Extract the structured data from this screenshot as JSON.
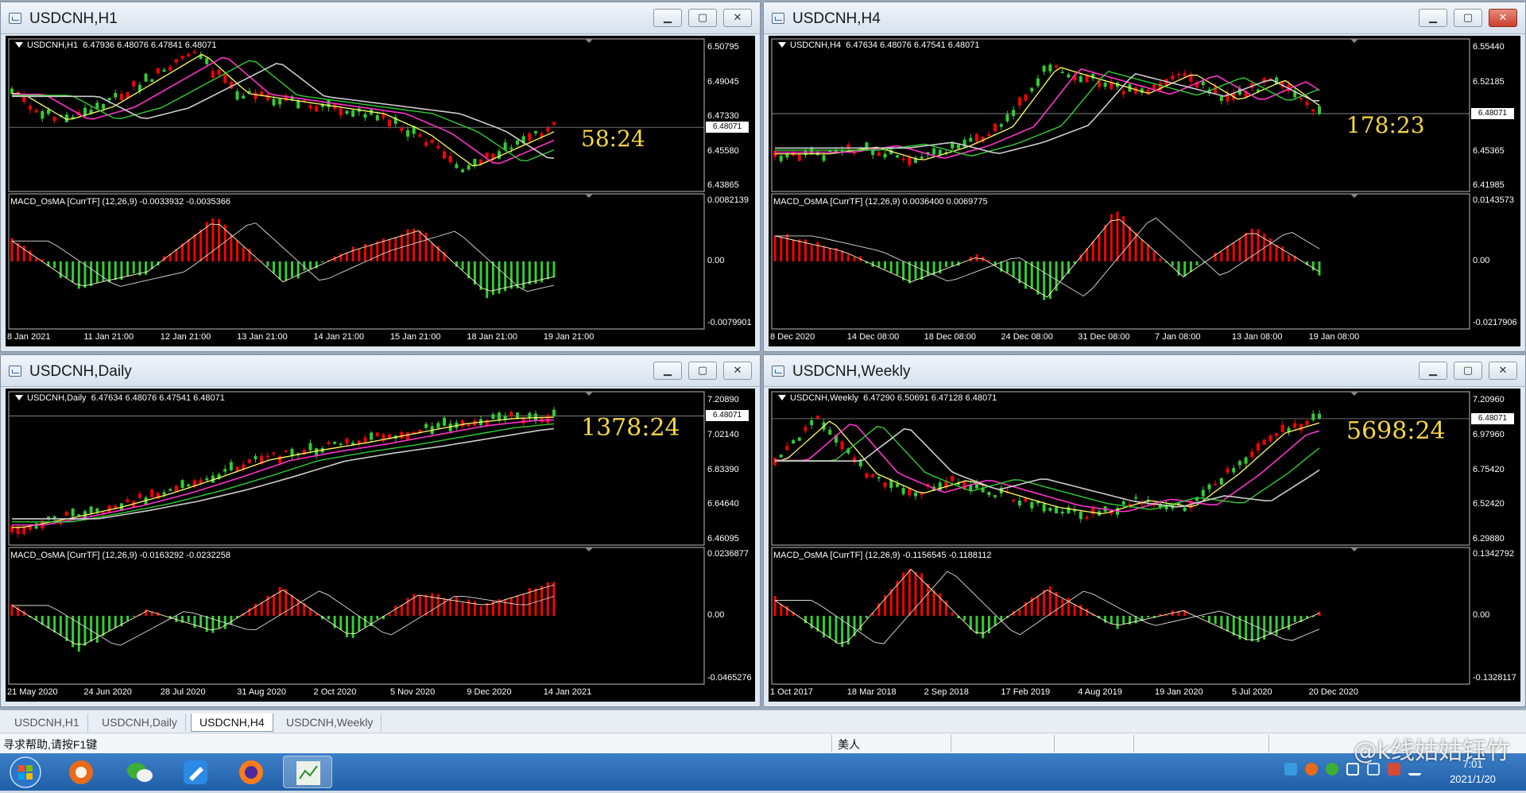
{
  "windows": [
    {
      "title": "USDCNH,H1",
      "close_style": "plain",
      "symbol_line": "USDCNH,H1  6.47936 6.48076 6.47841 6.48071",
      "price_labels": [
        "6.50795",
        "6.49045",
        "6.47330",
        "6.45580",
        "6.43865"
      ],
      "current_price": "6.48071",
      "macd_line": "MACD_OsMA [CurrTF] (12,26,9) -0.0033932 -0.0035366",
      "macd_labels": [
        "0.0082139",
        "0.00",
        "-0.0079901"
      ],
      "time_labels": [
        "8 Jan 2021",
        "11 Jan 21:00",
        "12 Jan 21:00",
        "13 Jan 21:00",
        "14 Jan 21:00",
        "15 Jan 21:00",
        "18 Jan 21:00",
        "19 Jan 21:00"
      ],
      "timer": "58:24"
    },
    {
      "title": "USDCNH,H4",
      "close_style": "red",
      "symbol_line": "USDCNH,H4  6.47634 6.48076 6.47541 6.48071",
      "price_labels": [
        "6.55440",
        "6.52185",
        "6.48745",
        "6.45365",
        "6.41985"
      ],
      "current_price": "6.48071",
      "macd_line": "MACD_OsMA [CurrTF] (12,26,9) 0.0036400 0.0069775",
      "macd_labels": [
        "0.0143573",
        "0.00",
        "-0.0217906"
      ],
      "time_labels": [
        "8 Dec 2020",
        "14 Dec 08:00",
        "18 Dec 08:00",
        "24 Dec 08:00",
        "31 Dec 08:00",
        "7 Jan 08:00",
        "13 Jan 08:00",
        "19 Jan 08:00"
      ],
      "timer": "178:23"
    },
    {
      "title": "USDCNH,Daily",
      "close_style": "plain",
      "symbol_line": "USDCNH,Daily  6.47634 6.48076 6.47541 6.48071",
      "price_labels": [
        "7.20890",
        "7.02140",
        "6.83390",
        "6.64640",
        "6.46095"
      ],
      "current_price": "6.48071",
      "macd_line": "MACD_OsMA [CurrTF] (12,26,9) -0.0163292 -0.0232258",
      "macd_labels": [
        "0.0236877",
        "0.00",
        "-0.0465276"
      ],
      "time_labels": [
        "21 May 2020",
        "24 Jun 2020",
        "28 Jul 2020",
        "31 Aug 2020",
        "2 Oct 2020",
        "5 Nov 2020",
        "9 Dec 2020",
        "14 Jan 2021"
      ],
      "timer": "1378:24"
    },
    {
      "title": "USDCNH,Weekly",
      "close_style": "plain",
      "symbol_line": "USDCNH,Weekly  6.47290 6.50691 6.47128 6.48071",
      "price_labels": [
        "7.20960",
        "6.97960",
        "6.75420",
        "6.52420",
        "6.29880"
      ],
      "current_price": "6.48071",
      "macd_line": "MACD_OsMA [CurrTF] (12,26,9) -0.1156545 -0.1188112",
      "macd_labels": [
        "0.1342792",
        "0.00",
        "-0.1328117"
      ],
      "time_labels": [
        "1 Oct 2017",
        "18 Mar 2018",
        "2 Sep 2018",
        "17 Feb 2019",
        "4 Aug 2019",
        "19 Jan 2020",
        "5 Jul 2020",
        "20 Dec 2020"
      ],
      "timer": "5698:24"
    }
  ],
  "tabs": [
    "USDCNH,H1",
    "USDCNH,Daily",
    "USDCNH,H4",
    "USDCNH,Weekly"
  ],
  "active_tab": "USDCNH,H4",
  "status": {
    "help": "寻求帮助,请按F1键",
    "profile": "美人"
  },
  "taskbar": {
    "apps": [
      "start-orb",
      "ie-app",
      "wechat-app",
      "notes-app",
      "firefox-app",
      "trading-app"
    ],
    "time": "7:01",
    "date": "2021/1/20"
  },
  "watermark": "@k线姑姑钰竹",
  "colors": {
    "bull_candle": "#32cd32",
    "bear_candle": "#ff0000",
    "ma_fast": "#ffff66",
    "ma_mid": "#ff33cc",
    "ma_slow": "#33cc33",
    "ma_long": "#cccccc",
    "timer": "#f5d742"
  }
}
